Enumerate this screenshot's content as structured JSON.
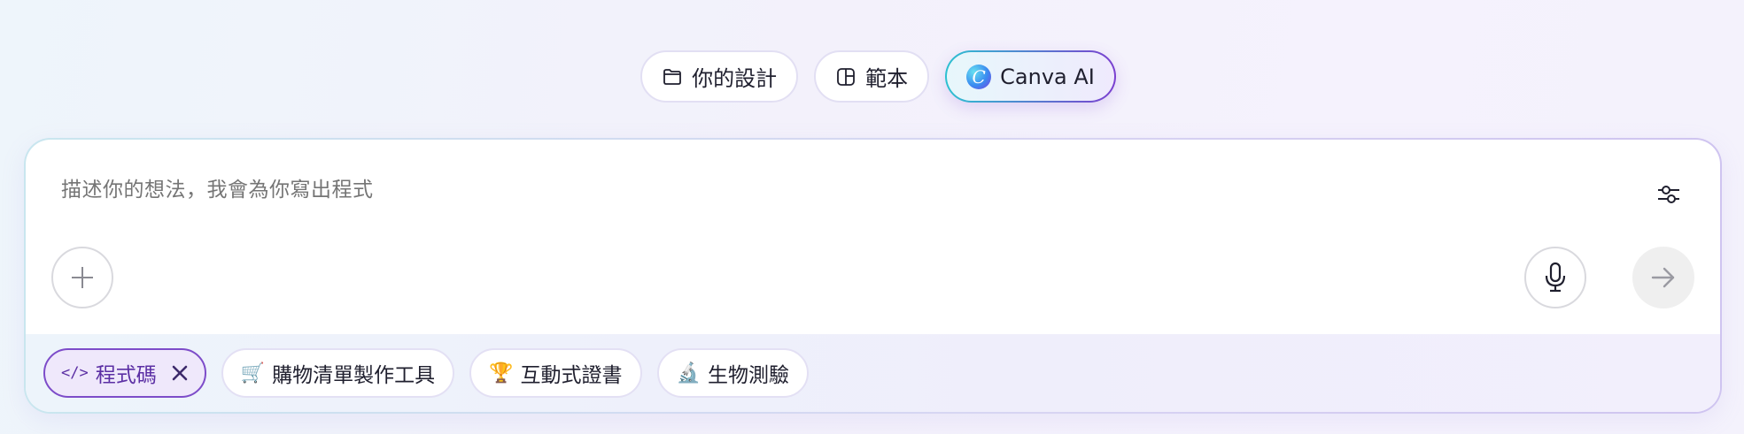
{
  "top_tabs": [
    {
      "label": "你的設計",
      "icon": "folder-icon"
    },
    {
      "label": "範本",
      "icon": "template-icon"
    },
    {
      "label": "Canva AI",
      "icon": "canva-ai-logo-icon",
      "active": true
    }
  ],
  "ai_logo_letter": "C",
  "prompt": {
    "placeholder": "描述你的想法，我會為你寫出程式"
  },
  "chips": {
    "code": {
      "label": "程式碼",
      "icon": "</>"
    },
    "shopping": {
      "label": "購物清單製作工具",
      "emoji": "🛒"
    },
    "certificate": {
      "label": "互動式證書",
      "emoji": "🏆"
    },
    "biology": {
      "label": "生物測驗",
      "emoji": "🔬"
    }
  },
  "colors": {
    "accent_purple": "#7d4cc9",
    "accent_teal": "#2dc1d1",
    "placeholder_gray": "#6d6f78"
  }
}
